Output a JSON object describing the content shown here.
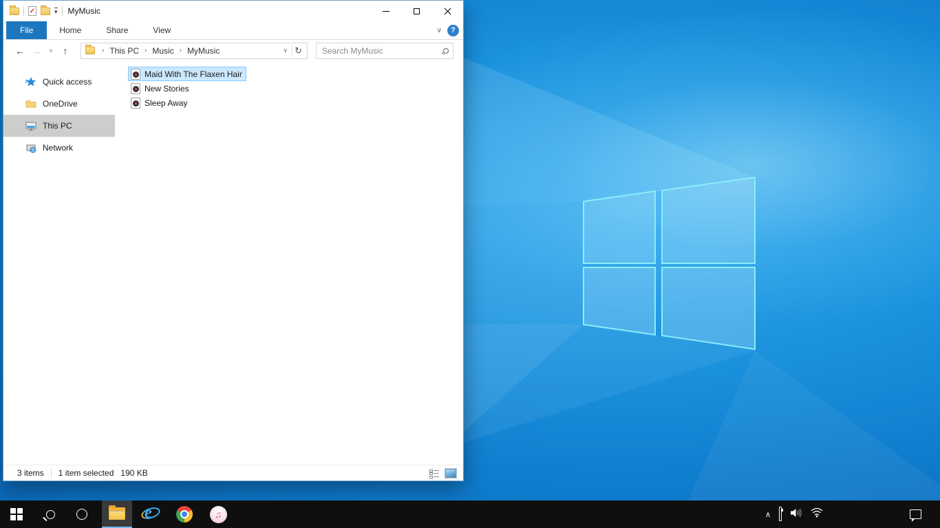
{
  "glyphs": {
    "qat_check": "✓",
    "qat_dropdown": "▾",
    "nav_back": "←",
    "nav_forward": "→",
    "nav_history_chevron": "∨",
    "nav_up": "↑",
    "crumb_sep": "›",
    "address_chevron": "∨",
    "refresh": "↻",
    "ribbon_chevron": "∨",
    "help": "?",
    "tray_chevron": "∧",
    "itunes_note": "♫"
  },
  "window": {
    "title": "MyMusic",
    "tabs": [
      {
        "label": "File"
      },
      {
        "label": "Home"
      },
      {
        "label": "Share"
      },
      {
        "label": "View"
      }
    ],
    "breadcrumb": {
      "items": [
        "This PC",
        "Music",
        "MyMusic"
      ]
    },
    "search": {
      "placeholder": "Search MyMusic"
    },
    "sidebar": {
      "items": [
        {
          "label": "Quick access"
        },
        {
          "label": "OneDrive"
        },
        {
          "label": "This PC",
          "selected": true
        },
        {
          "label": "Network"
        }
      ]
    },
    "files": {
      "items": [
        {
          "name": "Maid With The Flaxen Hair",
          "selected": true
        },
        {
          "name": "New Stories"
        },
        {
          "name": "Sleep Away"
        }
      ]
    },
    "status": {
      "count": "3 items",
      "selection": "1 item selected",
      "size": "190 KB"
    }
  },
  "colors": {
    "accent": "#1d77c0",
    "file_tab_bg": "#1d77c0",
    "selection_bg": "#cce8ff",
    "selection_border": "#84c7ff",
    "sidebar_selected_bg": "#cdcdcd",
    "taskbar_bg": "#0f0f0f",
    "desktop_blue": "#0f7ccd"
  }
}
